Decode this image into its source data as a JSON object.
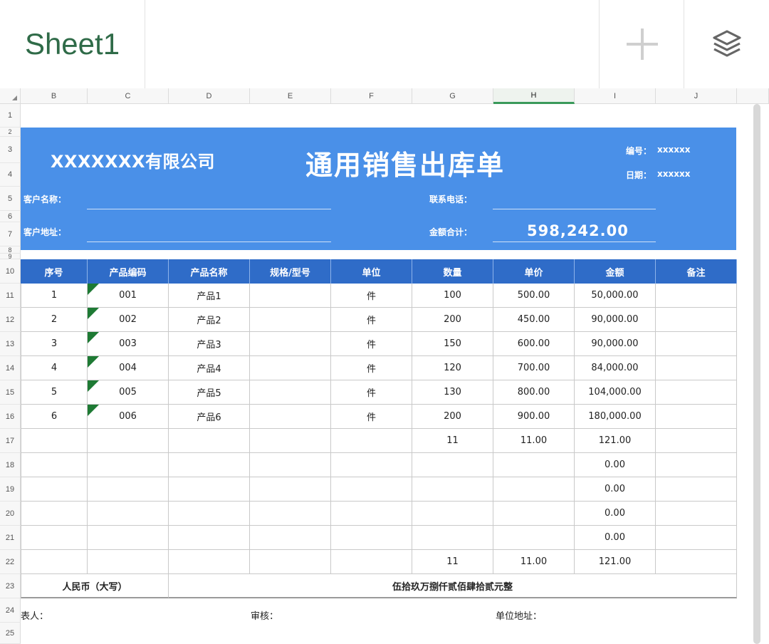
{
  "sheet_tab": {
    "name": "Sheet1"
  },
  "toolbar": {
    "add_icon": "plus-icon",
    "layers_icon": "layers-icon"
  },
  "columns": [
    "B",
    "C",
    "D",
    "E",
    "F",
    "G",
    "H",
    "I",
    "J"
  ],
  "selected_column": "H",
  "rows": [
    "1",
    "2",
    "3",
    "4",
    "5",
    "6",
    "7",
    "8",
    "9",
    "10",
    "11",
    "12",
    "13",
    "14",
    "15",
    "16",
    "17",
    "18",
    "19",
    "20",
    "21",
    "22",
    "23",
    "24",
    "25"
  ],
  "form": {
    "company": "XXXXXXX有限公司",
    "title": "通用销售出库单",
    "number_label": "编号：",
    "number_value": "xxxxxx",
    "date_label": "日期：",
    "date_value": "xxxxxx",
    "customer_name_label": "客户名称：",
    "customer_address_label": "客户地址：",
    "phone_label": "联系电话：",
    "total_label": "金额合计：",
    "total_value": "598,242.00"
  },
  "table": {
    "headers": [
      "序号",
      "产品编码",
      "产品名称",
      "规格/型号",
      "单位",
      "数量",
      "单价",
      "金额",
      "备注"
    ],
    "rows": [
      [
        "1",
        "001",
        "产品1",
        "",
        "件",
        "100",
        "500.00",
        "50,000.00",
        ""
      ],
      [
        "2",
        "002",
        "产品2",
        "",
        "件",
        "200",
        "450.00",
        "90,000.00",
        ""
      ],
      [
        "3",
        "003",
        "产品3",
        "",
        "件",
        "150",
        "600.00",
        "90,000.00",
        ""
      ],
      [
        "4",
        "004",
        "产品4",
        "",
        "件",
        "120",
        "700.00",
        "84,000.00",
        ""
      ],
      [
        "5",
        "005",
        "产品5",
        "",
        "件",
        "130",
        "800.00",
        "104,000.00",
        ""
      ],
      [
        "6",
        "006",
        "产品6",
        "",
        "件",
        "200",
        "900.00",
        "180,000.00",
        ""
      ],
      [
        "",
        "",
        "",
        "",
        "",
        "11",
        "11.00",
        "121.00",
        ""
      ],
      [
        "",
        "",
        "",
        "",
        "",
        "",
        "",
        "0.00",
        ""
      ],
      [
        "",
        "",
        "",
        "",
        "",
        "",
        "",
        "0.00",
        ""
      ],
      [
        "",
        "",
        "",
        "",
        "",
        "",
        "",
        "0.00",
        ""
      ],
      [
        "",
        "",
        "",
        "",
        "",
        "",
        "",
        "0.00",
        ""
      ],
      [
        "",
        "",
        "",
        "",
        "",
        "11",
        "11.00",
        "121.00",
        ""
      ]
    ],
    "rmb_label": "人民币（大写）",
    "rmb_value": "伍拾玖万捌仟贰佰肆拾贰元整"
  },
  "footer": {
    "preparer": "表人：",
    "reviewer": "审核：",
    "address": "单位地址："
  },
  "colors": {
    "band": "#4a90e8",
    "table_header": "#2f6cc8",
    "accent_green": "#3a9a5a",
    "flag": "#1e7a34"
  }
}
